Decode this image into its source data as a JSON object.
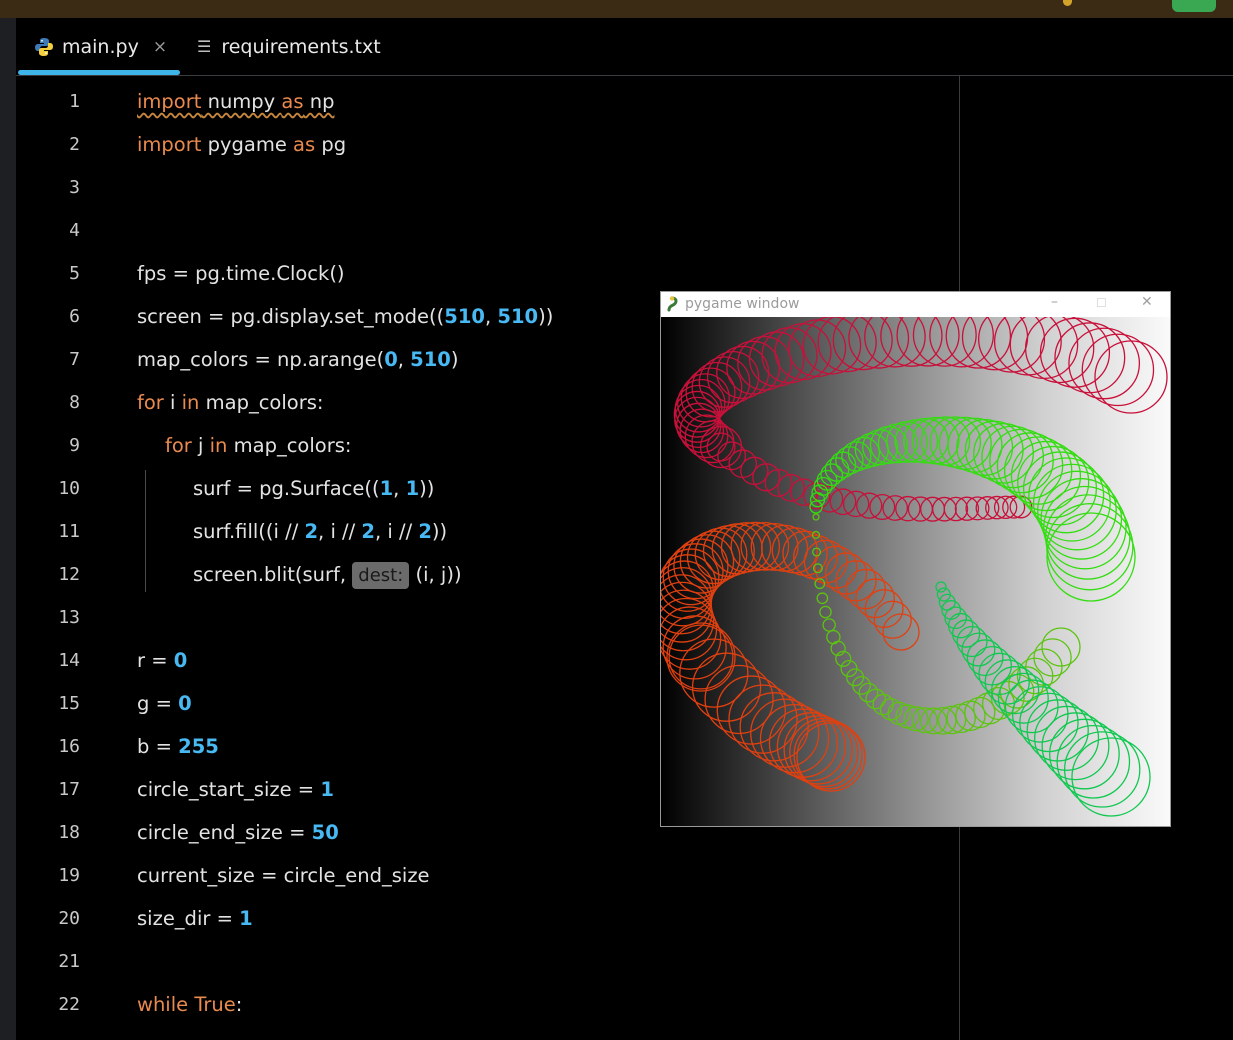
{
  "tabs": [
    {
      "label": "main.py",
      "icon": "python-icon",
      "close": "×",
      "active": true
    },
    {
      "label": "requirements.txt",
      "icon": "text-file-icon",
      "active": false
    }
  ],
  "editor": {
    "lines": [
      {
        "n": "1"
      },
      {
        "n": "2"
      },
      {
        "n": "3"
      },
      {
        "n": "4"
      },
      {
        "n": "5"
      },
      {
        "n": "6"
      },
      {
        "n": "7"
      },
      {
        "n": "8"
      },
      {
        "n": "9"
      },
      {
        "n": "10"
      },
      {
        "n": "11"
      },
      {
        "n": "12"
      },
      {
        "n": "13"
      },
      {
        "n": "14"
      },
      {
        "n": "15"
      },
      {
        "n": "16"
      },
      {
        "n": "17"
      },
      {
        "n": "18"
      },
      {
        "n": "19"
      },
      {
        "n": "20"
      },
      {
        "n": "21"
      },
      {
        "n": "22"
      }
    ],
    "tokens": {
      "import": "import",
      "numpy": " numpy ",
      "as": "as",
      "np": " np",
      "pygame": " pygame ",
      "pg": " pg",
      "l5": "fps = pg.time.Clock()",
      "l6a": "screen = pg.display.set_mode((",
      "l6n1": "510",
      "l6c": ", ",
      "l6n2": "510",
      "l6e": "))",
      "l7a": "map_colors = np.arange(",
      "l7n1": "0",
      "l7c": ", ",
      "l7n2": "510",
      "l7e": ")",
      "for": "for",
      "l8b": " i ",
      "in": "in",
      "l8c": " map_colors:",
      "l9b": " j ",
      "l9c": " map_colors:",
      "l10a": "surf = pg.Surface((",
      "l10n1": "1",
      "l10c": ", ",
      "l10n2": "1",
      "l10e": "))",
      "l11a": "surf.fill((i // ",
      "l11n1": "2",
      "l11b": ", i // ",
      "l11n2": "2",
      "l11c": ", i // ",
      "l11n3": "2",
      "l11e": "))",
      "l12a": "screen.blit(surf, ",
      "l12hint": "dest:",
      "l12b": " (i, j))",
      "l14a": "r = ",
      "l14n": "0",
      "l15a": "g = ",
      "l15n": "0",
      "l16a": "b = ",
      "l16n": "255",
      "l17a": "circle_start_size = ",
      "l17n": "1",
      "l18a": "circle_end_size = ",
      "l18n": "50",
      "l19": "current_size = circle_end_size",
      "l20a": "size_dir = ",
      "l20n": "1",
      "while": "while",
      "true": " True",
      "colon": ":"
    }
  },
  "pygame_window": {
    "title": "pygame window",
    "minimize": "–",
    "maximize": "☐",
    "close": "✕"
  },
  "colors": {
    "keyword": "#ea8a4e",
    "number": "#48b9f2",
    "tab_accent": "#3eb4e8",
    "spiral_red": "#c8103a",
    "spiral_green": "#33dd10",
    "spiral_orange": "#e04010"
  }
}
